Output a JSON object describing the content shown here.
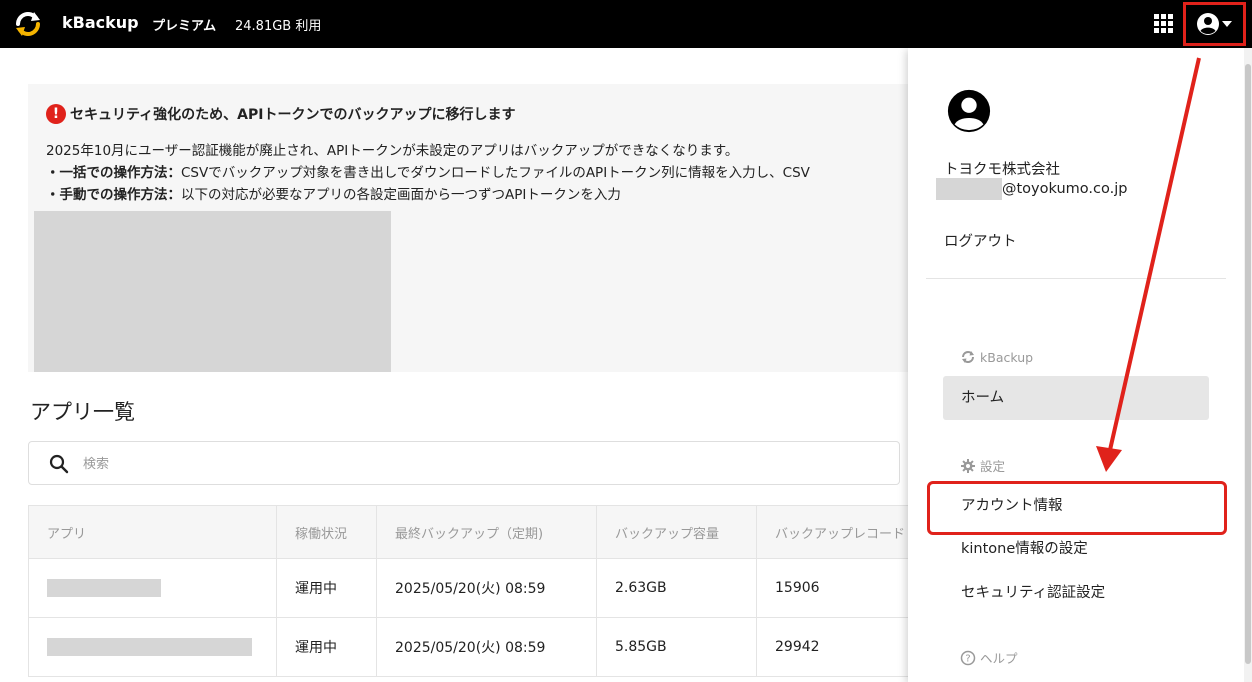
{
  "header": {
    "app_name": "kBackup",
    "plan": "プレミアム",
    "usage": "24.81GB 利用",
    "icons": [
      "kbackup-logo",
      "apps-grid-icon",
      "account-circle-icon",
      "caret-down-icon"
    ],
    "background": "#000000",
    "highlight_color": "#e0221b"
  },
  "notice": {
    "title": "セキュリティ強化のため、APIトークンでのバックアップに移行します",
    "line1": "2025年10月にユーザー認証機能が廃止され、APIトークンが未設定のアプリはバックアップができなくなります。",
    "bulk_label": "・一括での操作方法：",
    "bulk_text": "CSVでバックアップ対象を書き出しでダウンロードしたファイルのAPIトークン列に情報を入力し、CSV",
    "manual_label": "・手動での操作方法：",
    "manual_text": "以下の対応が必要なアプリの各設定画面から一つずつAPIトークンを入力"
  },
  "app_list": {
    "title": "アプリ一覧",
    "search_placeholder": "検索",
    "columns": [
      "アプリ",
      "稼働状況",
      "最終バックアップ（定期)",
      "バックアップ容量",
      "バックアップレコード"
    ],
    "rows": [
      {
        "status": "運用中",
        "last_backup": "2025/05/20(火) 08:59",
        "size": "2.63GB",
        "records": "15906"
      },
      {
        "status": "運用中",
        "last_backup": "2025/05/20(火) 08:59",
        "size": "5.85GB",
        "records": "29942"
      }
    ]
  },
  "account_panel": {
    "company": "トヨクモ株式会社",
    "email_domain": "@toyokumo.co.jp",
    "logout": "ログアウト",
    "section_kbackup": "kBackup",
    "home": "ホーム",
    "section_settings": "設定",
    "account_info": "アカウント情報",
    "kintone_settings": "kintone情報の設定",
    "security_settings": "セキュリティ認証設定",
    "section_help": "ヘルプ"
  }
}
